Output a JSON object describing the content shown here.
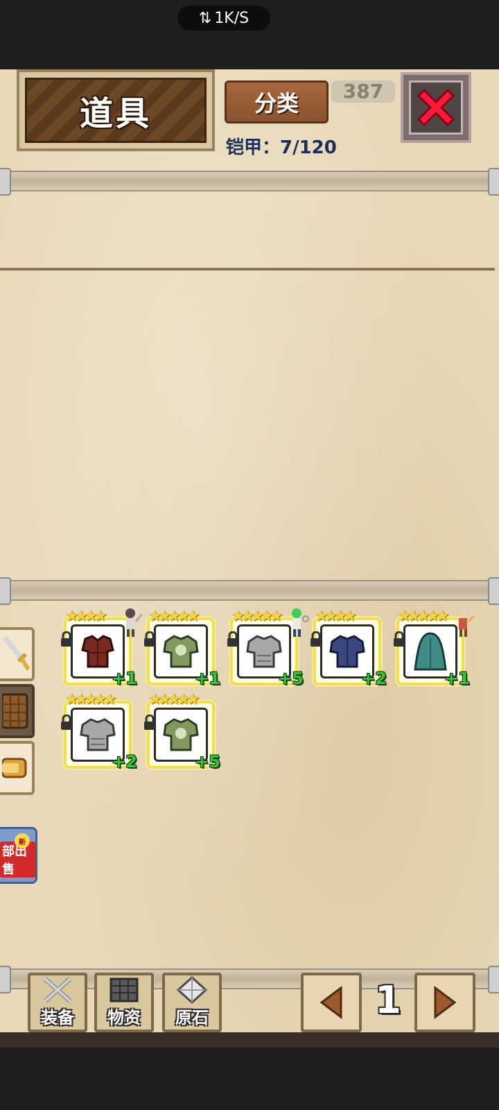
{
  "status_bar": {
    "network_speed": "1K/S"
  },
  "header": {
    "title": "道具",
    "category_button": "分类",
    "armor_count": "铠甲：7/120",
    "background_number": "387"
  },
  "items": [
    {
      "stars": "★★★★",
      "plus": "+1",
      "armor_color": "#7a2a22",
      "has_character": true
    },
    {
      "stars": "★★★★★",
      "plus": "+1",
      "armor_color": "#7f9a5c",
      "has_character": false
    },
    {
      "stars": "★★★★★",
      "plus": "+5",
      "armor_color": "#a8a8a8",
      "has_character": true
    },
    {
      "stars": "★★★★",
      "plus": "+2",
      "armor_color": "#3b4780",
      "has_character": false
    },
    {
      "stars": "★★★★★",
      "plus": "+1",
      "armor_color": "#3f8c86",
      "has_character": true
    },
    {
      "stars": "★★★★★",
      "plus": "+2",
      "armor_color": "#a8a8a8",
      "has_character": false
    },
    {
      "stars": "★★★★★",
      "plus": "+5",
      "armor_color": "#7f9a5c",
      "has_character": false
    }
  ],
  "side_tabs": {
    "sell_label": "部出售",
    "new_badge": "新"
  },
  "bottom_buttons": {
    "equipment": "装备",
    "materials": "物资",
    "ore": "原石"
  },
  "pagination": {
    "page": "1"
  }
}
